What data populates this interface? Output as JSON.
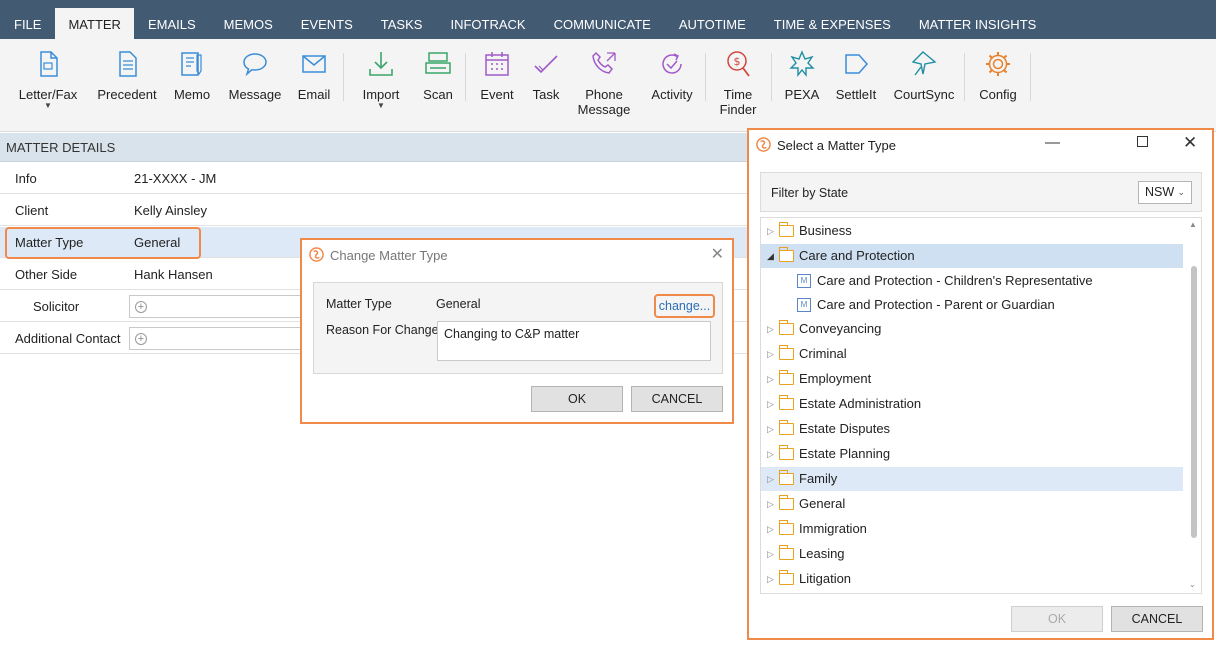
{
  "tabs": [
    "FILE",
    "MATTER",
    "EMAILS",
    "MEMOS",
    "EVENTS",
    "TASKS",
    "INFOTRACK",
    "COMMUNICATE",
    "AUTOTIME",
    "TIME & EXPENSES",
    "MATTER INSIGHTS"
  ],
  "ribbon": {
    "letter_fax": "Letter/Fax",
    "precedent": "Precedent",
    "memo": "Memo",
    "message": "Message",
    "email": "Email",
    "import": "Import",
    "scan": "Scan",
    "event": "Event",
    "task": "Task",
    "phone_message_1": "Phone",
    "phone_message_2": "Message",
    "activity": "Activity",
    "time_finder_1": "Time",
    "time_finder_2": "Finder",
    "pexa": "PEXA",
    "settleit": "SettleIt",
    "courtsync": "CourtSync",
    "config": "Config"
  },
  "matter_details": {
    "header": "MATTER DETAILS",
    "rows": [
      {
        "label": "Info",
        "value": "21-XXXX - JM"
      },
      {
        "label": "Client",
        "value": "Kelly Ainsley"
      },
      {
        "label": "Matter Type",
        "value": "General"
      },
      {
        "label": "Other Side",
        "value": "Hank Hansen"
      },
      {
        "label": "Solicitor",
        "value": ""
      },
      {
        "label": "Additional Contact",
        "value": ""
      }
    ]
  },
  "change_dialog": {
    "title": "Change Matter Type",
    "matter_type_label": "Matter Type",
    "matter_type_value": "General",
    "change_link": "change...",
    "reason_label": "Reason For Change",
    "reason_value": "Changing to C&P matter",
    "ok": "OK",
    "cancel": "CANCEL"
  },
  "select_dialog": {
    "title": "Select a Matter Type",
    "filter_label": "Filter by State",
    "state": "NSW",
    "tree": [
      {
        "label": "Business"
      },
      {
        "label": "Care and Protection"
      },
      {
        "label": "Care and Protection - Children's Representative"
      },
      {
        "label": "Care and Protection - Parent or Guardian"
      },
      {
        "label": "Conveyancing"
      },
      {
        "label": "Criminal"
      },
      {
        "label": "Employment"
      },
      {
        "label": "Estate Administration"
      },
      {
        "label": "Estate Disputes"
      },
      {
        "label": "Estate Planning"
      },
      {
        "label": "Family"
      },
      {
        "label": "General"
      },
      {
        "label": "Immigration"
      },
      {
        "label": "Leasing"
      },
      {
        "label": "Litigation"
      }
    ],
    "ok": "OK",
    "cancel": "CANCEL"
  },
  "colors": {
    "tabbar": "#435a73",
    "highlight": "#f08a4b",
    "link": "#2b6fb8",
    "icon_blue": "#3a8dd8",
    "icon_green": "#3aa66b",
    "icon_purple": "#a05bc9",
    "icon_red": "#d2453e",
    "icon_teal": "#1e8fa3",
    "icon_orange": "#e8812c"
  }
}
